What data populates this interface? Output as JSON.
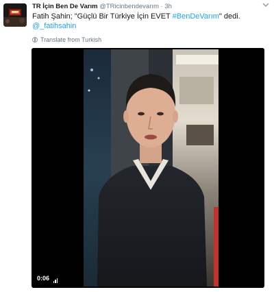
{
  "tweet": {
    "display_name": "TR İçin Ben De Varım",
    "handle": "@TRicinbendevarım",
    "separator": "·",
    "time": "3h",
    "text_part1": "Fatih Şahin; \"Güçlü Bir Türkiye İçin EVET ",
    "hashtag": "#BenDeVarım",
    "text_part2": "\" dedi.",
    "mention": "@_fatihsahin",
    "translate_label": "Translate from Turkish"
  },
  "video": {
    "duration": "0:06"
  },
  "colors": {
    "link": "#1da1f2",
    "meta": "#657786",
    "video_bg": "#000000"
  },
  "icons": {
    "menu": "chevron-down-icon",
    "translate": "globe-icon",
    "video_badge": "gif-bars-icon"
  }
}
